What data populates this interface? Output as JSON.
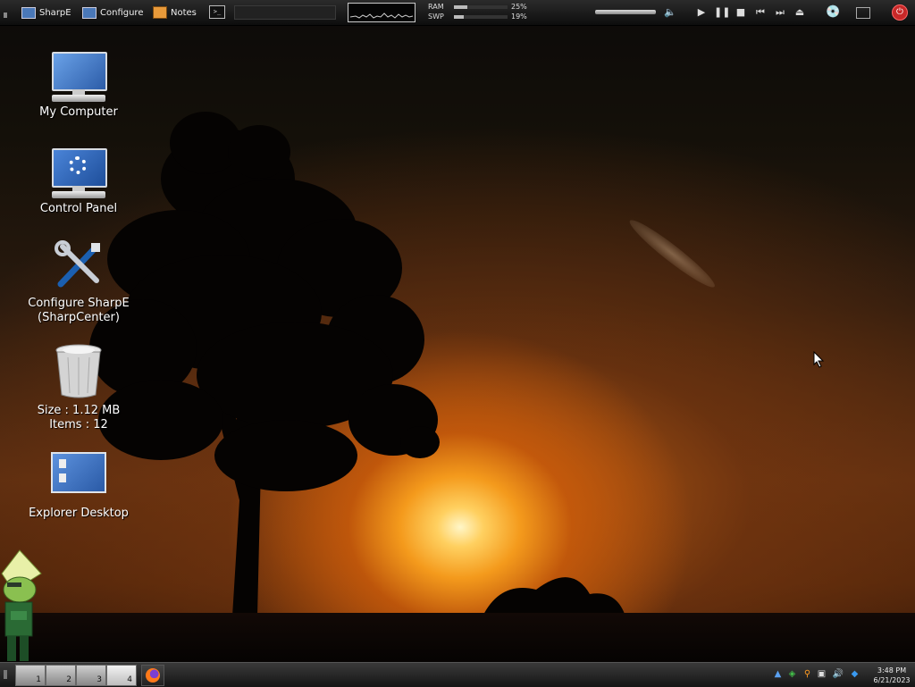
{
  "top_panel": {
    "launchers": [
      {
        "label": "SharpE",
        "icon": "monitor-icon"
      },
      {
        "label": "Configure",
        "icon": "monitor-icon"
      },
      {
        "label": "Notes",
        "icon": "notes-icon"
      }
    ],
    "terminal_icon": "terminal-icon",
    "memory": {
      "ram_label": "RAM",
      "ram_value": "25%",
      "ram_fraction": 0.25,
      "swp_label": "SWP",
      "swp_value": "19%",
      "swp_fraction": 0.19
    },
    "media_controls": [
      "volume-icon",
      "play-icon",
      "pause-icon",
      "stop-icon",
      "prev-icon",
      "next-icon",
      "eject-icon"
    ],
    "right_icons": [
      "disc-icon",
      "screen-icon",
      "power-icon"
    ]
  },
  "desktop": {
    "icons": [
      {
        "label": "My Computer",
        "icon": "computer-icon"
      },
      {
        "label": "Control Panel",
        "icon": "control-panel-icon"
      },
      {
        "label": "Configure SharpE",
        "label2": "(SharpCenter)",
        "icon": "tools-icon"
      },
      {
        "label": "Size : 1.12 MB",
        "label2": "Items : 12",
        "icon": "recycle-bin-icon"
      },
      {
        "label": "Explorer Desktop",
        "icon": "explorer-desktop-icon"
      }
    ]
  },
  "bottom_panel": {
    "workspaces": [
      "1",
      "2",
      "3",
      "4"
    ],
    "active_workspace": "4",
    "tray_icons": [
      "arrow-up-icon",
      "network-icon",
      "search-icon",
      "display-icon",
      "speaker-icon",
      "app-icon"
    ],
    "clock": {
      "time": "3:48 PM",
      "date": "6/21/2023"
    }
  }
}
